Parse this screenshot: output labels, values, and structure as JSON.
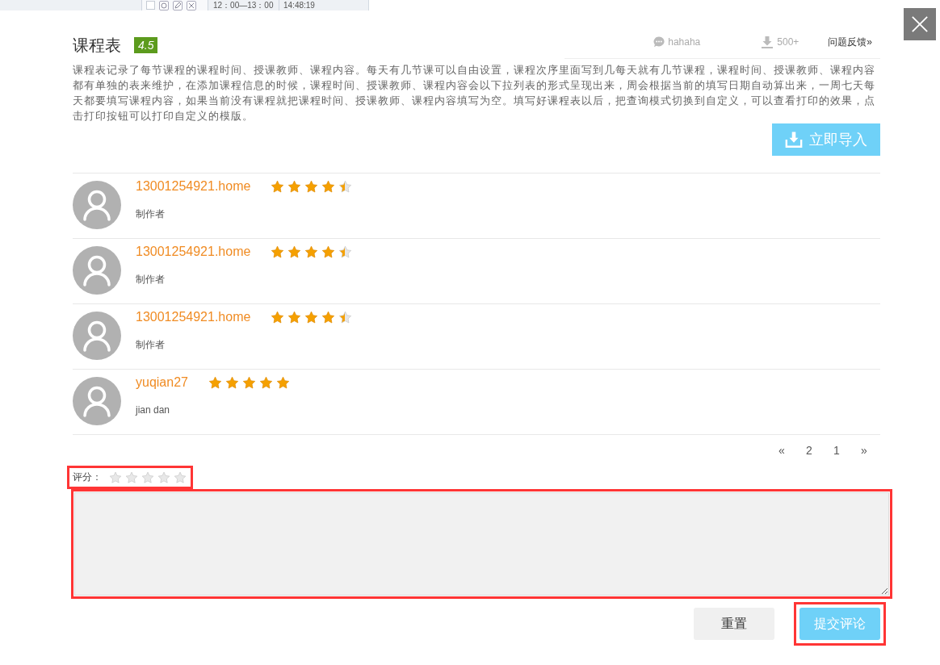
{
  "background_strip": {
    "checked": false,
    "time_range": "12：00—13：00",
    "time": "14:48:19"
  },
  "title": "课程表",
  "score_badge": "4.5",
  "meta": {
    "author": "hahaha",
    "downloads": "500+",
    "feedback_link": "问题反馈»"
  },
  "description": "课程表记录了每节课程的课程时间、授课教师、课程内容。每天有几节课可以自由设置，课程次序里面写到几每天就有几节课程，课程时间、授课教师、课程内容都有单独的表来维护，在添加课程信息的时候，课程时间、授课教师、课程内容会以下拉列表的形式呈现出来，周会根据当前的填写日期自动算出来，一周七天每天都要填写课程内容，如果当前没有课程就把课程时间、授课教师、课程内容填写为空。填写好课程表以后，把查询模式切换到自定义，可以查看打印的效果，点击打印按钮可以打印自定义的模版。",
  "import_button": "立即导入",
  "reviews": [
    {
      "user": "13001254921.home",
      "stars": 4.5,
      "comment": "制作者"
    },
    {
      "user": "13001254921.home",
      "stars": 4.5,
      "comment": "制作者"
    },
    {
      "user": "13001254921.home",
      "stars": 4.5,
      "comment": "制作者"
    },
    {
      "user": "yuqian27",
      "stars": 5,
      "comment": "jian dan"
    }
  ],
  "pagination": [
    "«",
    "2",
    "1",
    "»"
  ],
  "rating": {
    "label": "评分：",
    "stars": 0,
    "highlighted": true
  },
  "comment_box": {
    "highlighted": true
  },
  "buttons": [
    {
      "label": "重置",
      "kind": "reset",
      "highlighted": false
    },
    {
      "label": "提交评论",
      "kind": "submit",
      "highlighted": true
    }
  ]
}
